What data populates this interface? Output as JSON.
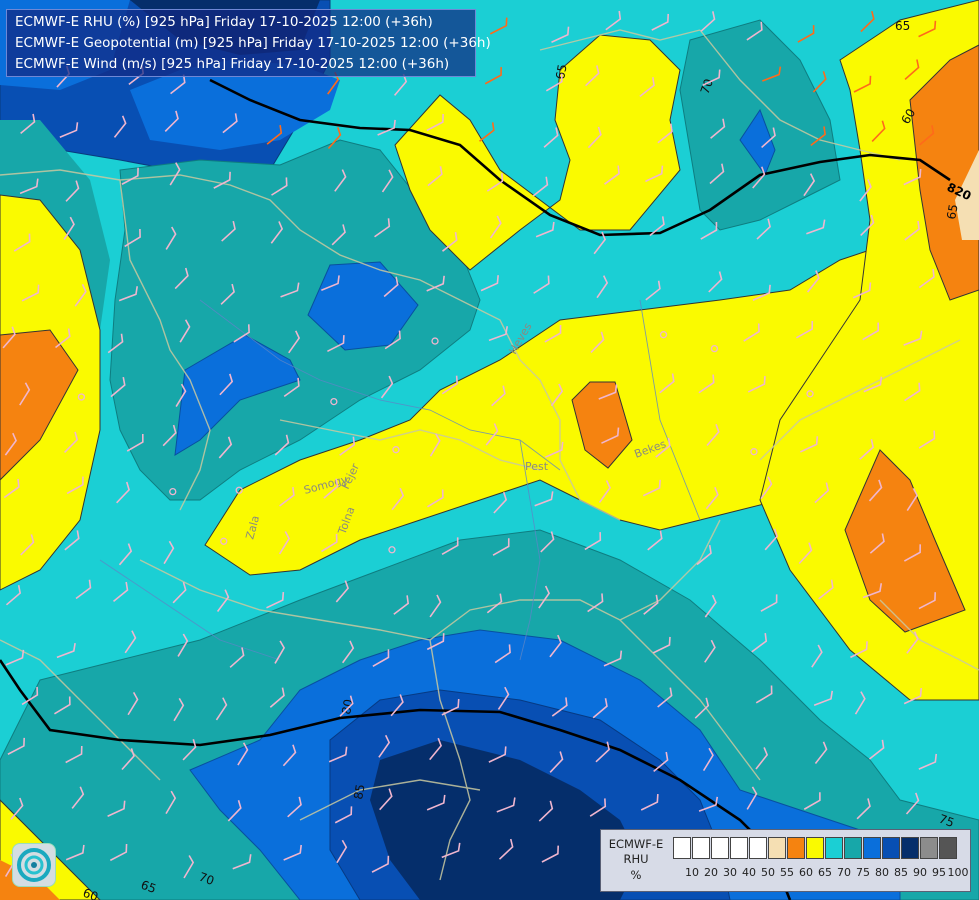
{
  "title": {
    "line1": "ECMWF-E RHU (%) [925 hPa] Friday 17-10-2025 12:00 (+36h)",
    "line2": "ECMWF-E Geopotential (m) [925 hPa] Friday 17-10-2025 12:00 (+36h)",
    "line3": "ECMWF-E Wind (m/s) [925 hPa] Friday 17-10-2025 12:00 (+36h)"
  },
  "legend": {
    "title_lines": [
      "ECMWF-E",
      "RHU",
      "%"
    ],
    "swatches": [
      {
        "color": "#ffffff",
        "label": "10"
      },
      {
        "color": "#ffffff",
        "label": "20"
      },
      {
        "color": "#ffffff",
        "label": "30"
      },
      {
        "color": "#ffffff",
        "label": "40"
      },
      {
        "color": "#ffffff",
        "label": "50"
      },
      {
        "color": "#f5dfb3",
        "label": "55"
      },
      {
        "color": "#f58310",
        "label": "60"
      },
      {
        "color": "#fafa00",
        "label": "65"
      },
      {
        "color": "#1bcfd4",
        "label": "70"
      },
      {
        "color": "#17a7a9",
        "label": "75"
      },
      {
        "color": "#0a6fdb",
        "label": "80"
      },
      {
        "color": "#084fb3",
        "label": "85"
      },
      {
        "color": "#052e6b",
        "label": "90"
      },
      {
        "color": "#8c8c8c",
        "label": "95"
      },
      {
        "color": "#555555",
        "label": "100"
      }
    ]
  },
  "contour_labels": [
    "65",
    "70",
    "60",
    "65",
    "65",
    "70",
    "75",
    "80",
    "85",
    "75",
    "60",
    "70",
    "65",
    "60"
  ],
  "geopotential_label": "820",
  "region_labels": [
    "Heves",
    "Pest",
    "Bekes",
    "Somogy",
    "Fejer",
    "Zala",
    "Tolna"
  ],
  "colors": {
    "title_bg": "#122882",
    "wind_barb_normal": "#f0b6cf",
    "wind_barb_strong": "#ff6a1a",
    "borders": "#c9c9a0",
    "geopotential_line": "#000000"
  },
  "logo_icon": "ecmwf-swirl-icon"
}
